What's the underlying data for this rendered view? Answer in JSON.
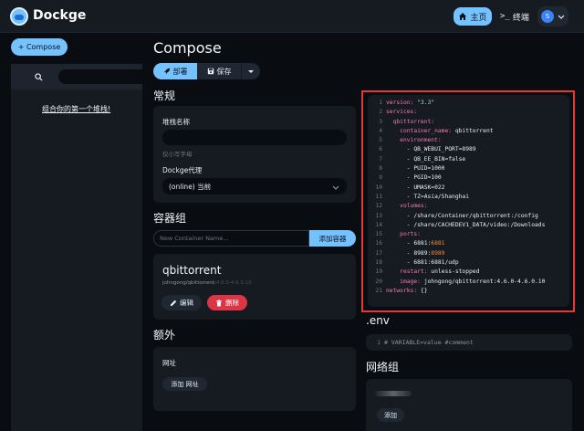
{
  "header": {
    "app_title": "Dockge",
    "home_label": "主页",
    "terminal_icon": ">_",
    "terminal_label": "终端",
    "avatar_letter": "S"
  },
  "sidebar": {
    "compose_button": "+ Compose",
    "stack_link": "组合你的第一个堆栈!"
  },
  "main": {
    "page_title": "Compose",
    "deploy_label": "部署",
    "save_label": "保存",
    "general_section": "常规",
    "stack_name_label": "堆栈名称",
    "stack_name_hint": "仅小写字母",
    "agent_label": "Dockge代理",
    "agent_value": "(online) 当前",
    "containers_section": "容器组",
    "container_input_placeholder": "New Container Name...",
    "add_container_button": "添加容器",
    "container": {
      "name": "qbittorrent",
      "image": "johngong/qbittorrent:",
      "image_version": "4.6.0-4.6.0.10",
      "edit_button": "编辑",
      "delete_button": "删除"
    },
    "extra_section": "额外",
    "url_label": "网址",
    "add_url_button": "添加 网址"
  },
  "editor": {
    "lines": [
      {
        "n": "1",
        "parts": [
          {
            "t": "version: ",
            "c": "k"
          },
          {
            "t": "\"3.3\"",
            "c": "str"
          }
        ]
      },
      {
        "n": "2",
        "parts": [
          {
            "t": "services:",
            "c": "k"
          }
        ]
      },
      {
        "n": "3",
        "parts": [
          {
            "t": "  qbittorrent:",
            "c": "k"
          }
        ]
      },
      {
        "n": "4",
        "parts": [
          {
            "t": "    container_name: ",
            "c": "k"
          },
          {
            "t": "qbittorrent",
            "c": "s"
          }
        ]
      },
      {
        "n": "5",
        "parts": [
          {
            "t": "    environment:",
            "c": "k"
          }
        ]
      },
      {
        "n": "6",
        "parts": [
          {
            "t": "      - QB_WEBUI_PORT=8989",
            "c": "s"
          }
        ]
      },
      {
        "n": "7",
        "parts": [
          {
            "t": "      - QB_EE_BIN=false",
            "c": "s"
          }
        ]
      },
      {
        "n": "8",
        "parts": [
          {
            "t": "      - PUID=1000",
            "c": "s"
          }
        ]
      },
      {
        "n": "9",
        "parts": [
          {
            "t": "      - PGID=100",
            "c": "s"
          }
        ]
      },
      {
        "n": "10",
        "parts": [
          {
            "t": "      - UMASK=022",
            "c": "s"
          }
        ]
      },
      {
        "n": "11",
        "parts": [
          {
            "t": "      - TZ=Asia/Shanghai",
            "c": "s"
          }
        ]
      },
      {
        "n": "12",
        "parts": [
          {
            "t": "    volumes:",
            "c": "k"
          }
        ]
      },
      {
        "n": "13",
        "parts": [
          {
            "t": "      - /share/Container/qbittorrent:/config",
            "c": "s"
          }
        ]
      },
      {
        "n": "14",
        "parts": [
          {
            "t": "      - /share/CACHEDEV1_DATA/video:/Downloads",
            "c": "s"
          }
        ]
      },
      {
        "n": "15",
        "parts": [
          {
            "t": "    ports:",
            "c": "k"
          }
        ]
      },
      {
        "n": "16",
        "parts": [
          {
            "t": "      - 6881:",
            "c": "s"
          },
          {
            "t": "6881",
            "c": "num"
          }
        ]
      },
      {
        "n": "17",
        "parts": [
          {
            "t": "      - 8989:",
            "c": "s"
          },
          {
            "t": "8989",
            "c": "num"
          }
        ]
      },
      {
        "n": "18",
        "parts": [
          {
            "t": "      - 6881:6881/udp",
            "c": "s"
          }
        ]
      },
      {
        "n": "19",
        "parts": [
          {
            "t": "    restart: ",
            "c": "k"
          },
          {
            "t": "unless-stopped",
            "c": "s"
          }
        ]
      },
      {
        "n": "20",
        "parts": [
          {
            "t": "    image: ",
            "c": "k"
          },
          {
            "t": "johngong/qbittorrent:4.6.0-4.6.0.10",
            "c": "s"
          }
        ]
      },
      {
        "n": "21",
        "parts": [
          {
            "t": "networks: ",
            "c": "k"
          },
          {
            "t": "{}",
            "c": "s"
          }
        ]
      }
    ]
  },
  "env": {
    "section": ".env",
    "line_number": "1",
    "line_text": "# VARIABLE=value #comment"
  },
  "networks": {
    "section": "网络组",
    "add_button": "添加"
  },
  "colors": {
    "accent": "#74c2ff",
    "danger": "#dc3545",
    "highlight_border": "#e53935"
  }
}
